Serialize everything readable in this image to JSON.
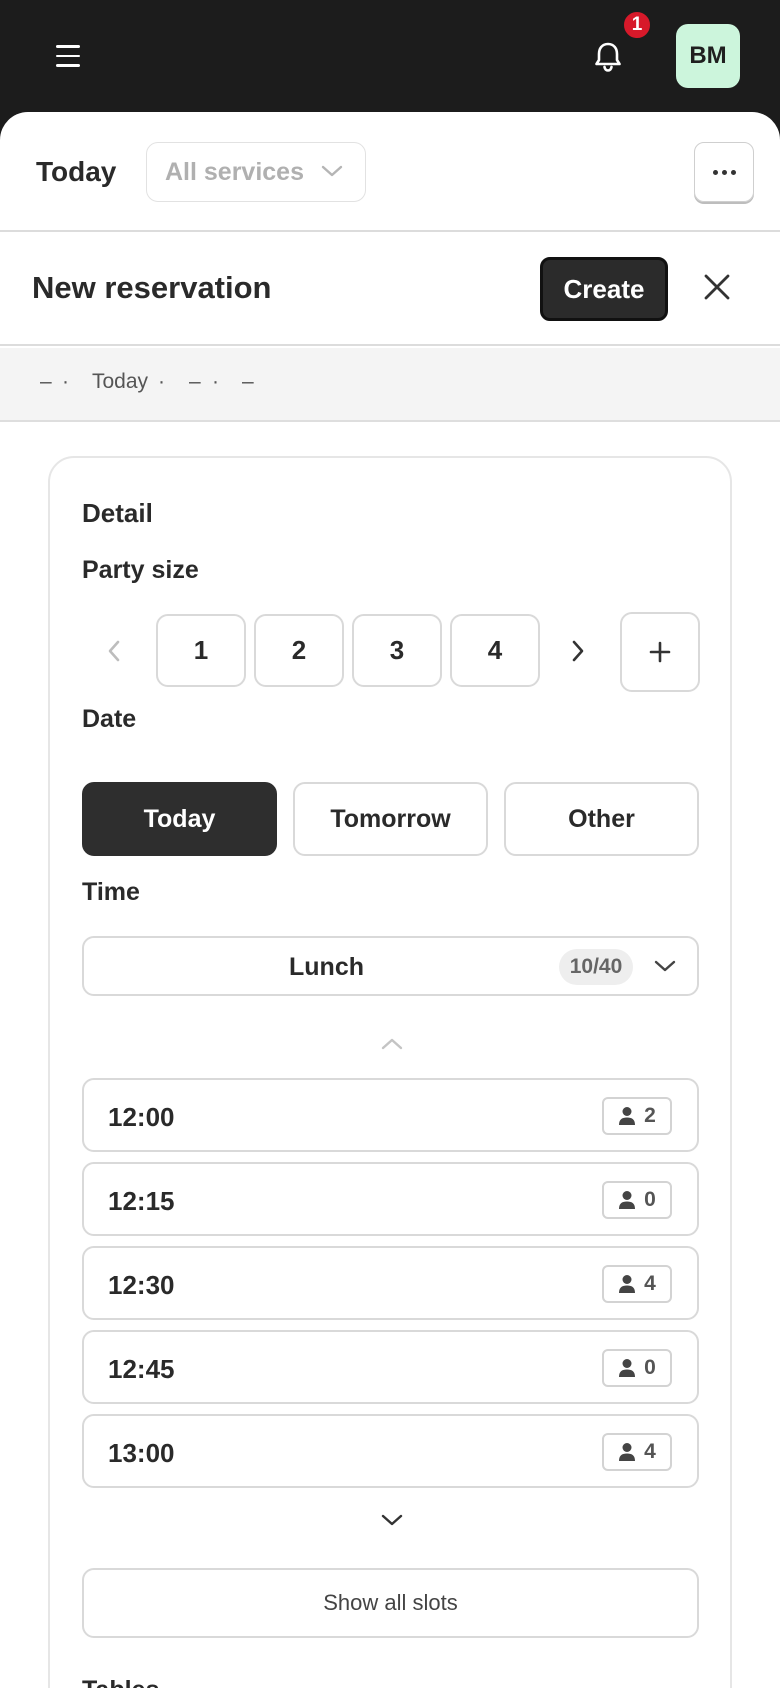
{
  "header": {
    "menu_icon": "hamburger-menu-icon",
    "bell_icon": "bell-icon",
    "notification_count": "1",
    "avatar_initials": "BM",
    "avatar_color": "#ccf5dc",
    "badge_color": "#d7192a"
  },
  "filter": {
    "title": "Today",
    "service_select": "All services"
  },
  "reservation": {
    "title": "New reservation",
    "create_label": "Create"
  },
  "summary": {
    "items": [
      "–",
      "·",
      "Today",
      "·",
      "–",
      "·",
      "–"
    ]
  },
  "detail": {
    "heading": "Detail",
    "party_size_label": "Party size",
    "party_sizes": [
      "1",
      "2",
      "3",
      "4"
    ],
    "date_label": "Date",
    "date_options": [
      "Today",
      "Tomorrow",
      "Other"
    ],
    "selected_date": "Today",
    "time_label": "Time",
    "service": {
      "name": "Lunch",
      "count": "10/40"
    },
    "slots": [
      {
        "time": "12:00",
        "covers": "2"
      },
      {
        "time": "12:15",
        "covers": "0"
      },
      {
        "time": "12:30",
        "covers": "4"
      },
      {
        "time": "12:45",
        "covers": "0"
      },
      {
        "time": "13:00",
        "covers": "4"
      }
    ],
    "show_all_label": "Show all slots",
    "tables_label": "Tables"
  }
}
